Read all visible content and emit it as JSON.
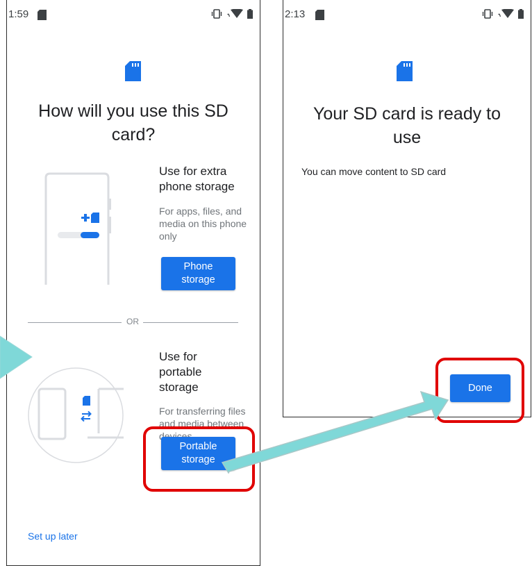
{
  "left_screen": {
    "status": {
      "time": "1:59"
    },
    "title": "How will you use this SD card?",
    "option_phone": {
      "title": "Use for extra phone storage",
      "description": "For apps, files, and media on this phone only",
      "button_label": "Phone storage"
    },
    "divider_label": "OR",
    "option_portable": {
      "title": "Use for portable storage",
      "description": "For transferring files and media between devices",
      "button_label": "Portable storage"
    },
    "setup_later_label": "Set up later"
  },
  "right_screen": {
    "status": {
      "time": "2:13"
    },
    "title": "Your SD card is ready to use",
    "message": "You can move content to SD card",
    "done_label": "Done"
  },
  "colors": {
    "accent": "#1a73e8",
    "highlight": "#e00000",
    "arrow": "#7fd8d8",
    "illustration_gray": "#dadce0"
  },
  "icons": [
    "sd-card-icon",
    "vibrate-icon",
    "wifi-icon",
    "battery-icon",
    "arrow-icon"
  ]
}
